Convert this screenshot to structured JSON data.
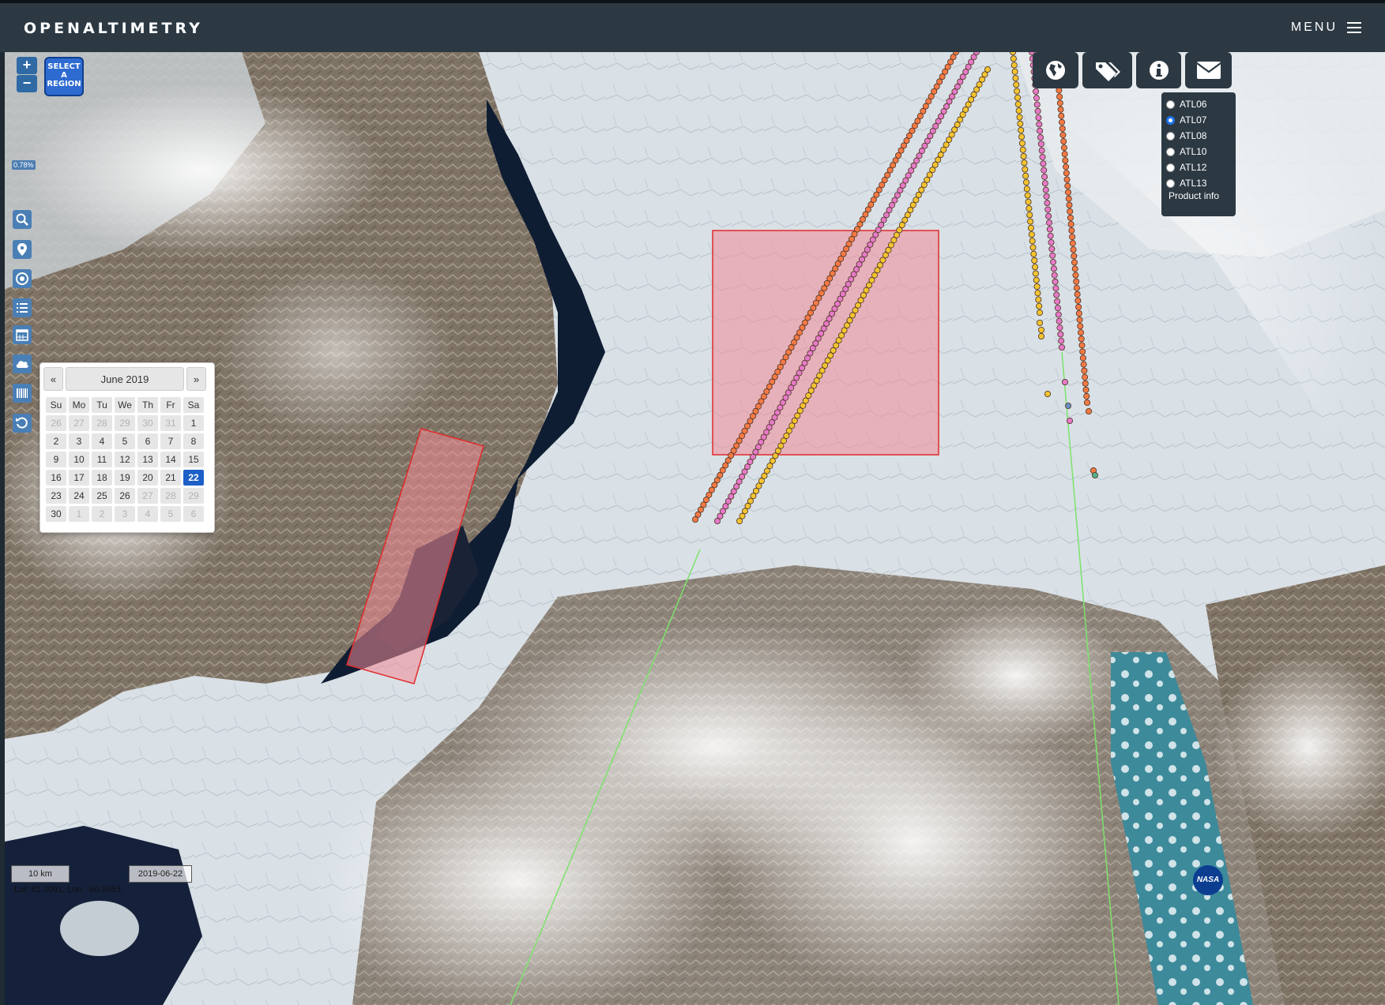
{
  "header": {
    "brand": "OPENALTIMETRY",
    "menu_label": "MENU"
  },
  "map_controls": {
    "zoom_in": "+",
    "zoom_out": "−",
    "select_region": [
      "SELECT",
      "A",
      "REGION"
    ],
    "coverage_percent": "0.78%"
  },
  "sidebar_icons": [
    "search-icon",
    "location-pin-icon",
    "target-icon",
    "list-icon",
    "calendar-icon",
    "cloud-icon",
    "barcode-icon",
    "reset-icon"
  ],
  "calendar": {
    "prev": "«",
    "next": "»",
    "month": "June 2019",
    "weekdays": [
      "Su",
      "Mo",
      "Tu",
      "We",
      "Th",
      "Fr",
      "Sa"
    ],
    "weeks": [
      [
        "26",
        "27",
        "28",
        "29",
        "30",
        "31",
        "1"
      ],
      [
        "2",
        "3",
        "4",
        "5",
        "6",
        "7",
        "8"
      ],
      [
        "9",
        "10",
        "11",
        "12",
        "13",
        "14",
        "15"
      ],
      [
        "16",
        "17",
        "18",
        "19",
        "20",
        "21",
        "22"
      ],
      [
        "23",
        "24",
        "25",
        "26",
        "27",
        "28",
        "29"
      ],
      [
        "30",
        "1",
        "2",
        "3",
        "4",
        "5",
        "6"
      ]
    ],
    "selected": "22"
  },
  "toolbar_icons": [
    "globe-icon",
    "tags-icon",
    "info-icon",
    "mail-icon"
  ],
  "products": {
    "options": [
      "ATL06",
      "ATL07",
      "ATL08",
      "ATL10",
      "ATL12",
      "ATL13"
    ],
    "selected": "ATL07",
    "info_label": "Product info"
  },
  "footer": {
    "scale": "10 km",
    "date": "2019-06-22",
    "coords": "Lat: 82.3091, Lon: -60.9653",
    "logo": "NASA"
  },
  "colors": {
    "header_bg": "#2c3943",
    "accent_blue": "#1d5fc7",
    "region_fill": "#f08a96",
    "track_orange": "#f47a45",
    "track_pink": "#e57ac7",
    "track_yellow": "#f2c431",
    "track_line": "#7ce36b"
  }
}
